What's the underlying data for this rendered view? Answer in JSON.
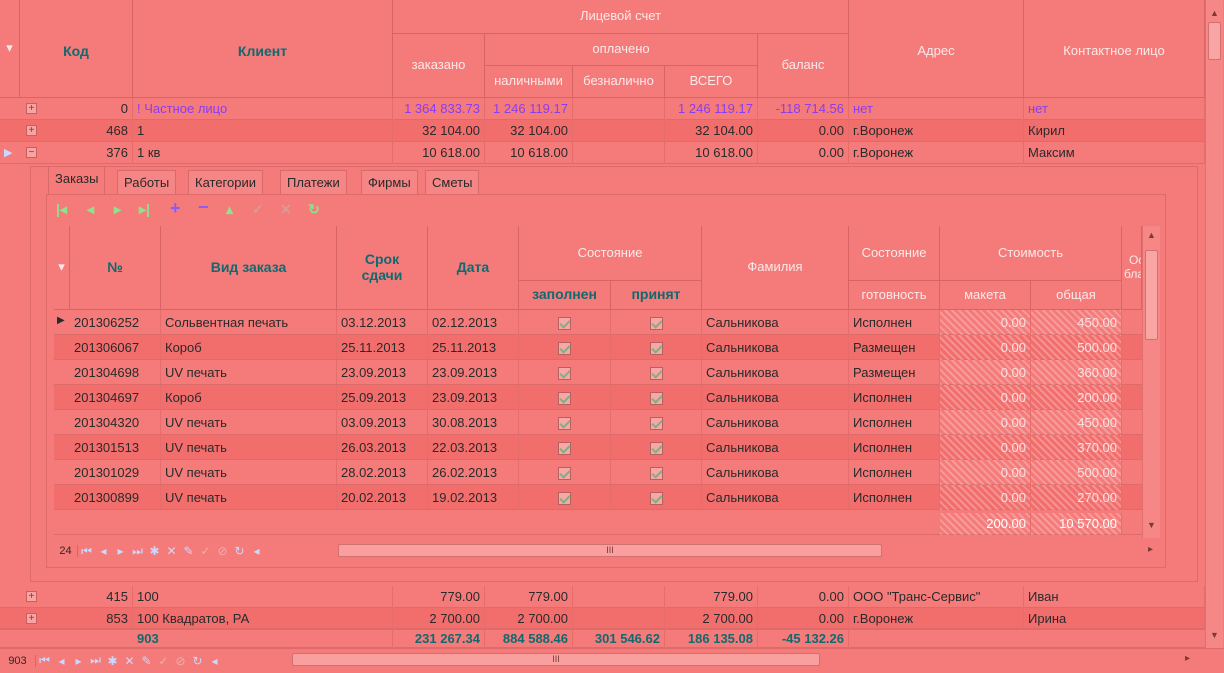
{
  "header": {
    "kod": "Код",
    "client": "Клиент",
    "account_group": "Лицевой счет",
    "ordered": "заказано",
    "paid": "оплачено",
    "cash": "наличными",
    "noncash": "безналично",
    "total": "ВСЕГО",
    "balance": "баланс",
    "address": "Адрес",
    "contact": "Контактное лицо"
  },
  "rows_top": [
    {
      "kod": "0",
      "client": "! Частное лицо",
      "ordered": "1 364 833.73",
      "cash": "1 246 119.17",
      "noncash": "",
      "total": "1 246 119.17",
      "balance": "-118 714.56",
      "address": "нет",
      "contact": "нет"
    },
    {
      "kod": "468",
      "client": "1",
      "ordered": "32 104.00",
      "cash": "32 104.00",
      "noncash": "",
      "total": "32 104.00",
      "balance": "0.00",
      "address": "г.Воронеж",
      "contact": "Кирил"
    },
    {
      "kod": "376",
      "client": "1 кв",
      "ordered": "10 618.00",
      "cash": "10 618.00",
      "noncash": "",
      "total": "10 618.00",
      "balance": "0.00",
      "address": "г.Воронеж",
      "contact": "Максим"
    }
  ],
  "rows_bottom": [
    {
      "kod": "415",
      "client": "100",
      "ordered": "779.00",
      "cash": "779.00",
      "noncash": "",
      "total": "779.00",
      "balance": "0.00",
      "address": "ООО \"Транс-Сервис\"",
      "contact": "Иван"
    },
    {
      "kod": "853",
      "client": "100 Квадратов, РА",
      "ordered": "2 700.00",
      "cash": "2 700.00",
      "noncash": "",
      "total": "2 700.00",
      "balance": "0.00",
      "address": "г.Воронеж",
      "contact": "Ирина"
    }
  ],
  "footer": {
    "count": "903",
    "ordered": "231 267.34",
    "cash": "884 588.46",
    "noncash": "301 546.62",
    "total": "186 135.08",
    "balance": "-45 132.26"
  },
  "tabs": [
    "Заказы",
    "Работы",
    "Категории",
    "Платежи",
    "Фирмы",
    "Сметы"
  ],
  "detail_header": {
    "num": "№",
    "type": "Вид заказа",
    "due": "Срок сдачи",
    "date": "Дата",
    "state": "Состояние",
    "filled": "заполнен",
    "accepted": "принят",
    "surname": "Фамилия",
    "state2": "Состояние",
    "readiness": "готовность",
    "cost": "Стоимость",
    "layout": "макета",
    "overall": "общая",
    "extra": "Осн бланк"
  },
  "orders": [
    {
      "num": "201306252",
      "type": "Сольвентная печать",
      "due": "03.12.2013",
      "date": "02.12.2013",
      "surname": "Сальникова",
      "readiness": "Исполнен",
      "layout": "0.00",
      "overall": "450.00"
    },
    {
      "num": "201306067",
      "type": "Короб",
      "due": "25.11.2013",
      "date": "25.11.2013",
      "surname": "Сальникова",
      "readiness": "Размещен",
      "layout": "0.00",
      "overall": "500.00"
    },
    {
      "num": "201304698",
      "type": "UV печать",
      "due": "23.09.2013",
      "date": "23.09.2013",
      "surname": "Сальникова",
      "readiness": "Размещен",
      "layout": "0.00",
      "overall": "360.00"
    },
    {
      "num": "201304697",
      "type": "Короб",
      "due": "25.09.2013",
      "date": "23.09.2013",
      "surname": "Сальникова",
      "readiness": "Исполнен",
      "layout": "0.00",
      "overall": "200.00"
    },
    {
      "num": "201304320",
      "type": "UV печать",
      "due": "03.09.2013",
      "date": "30.08.2013",
      "surname": "Сальникова",
      "readiness": "Исполнен",
      "layout": "0.00",
      "overall": "450.00"
    },
    {
      "num": "201301513",
      "type": "UV печать",
      "due": "26.03.2013",
      "date": "22.03.2013",
      "surname": "Сальникова",
      "readiness": "Исполнен",
      "layout": "0.00",
      "overall": "370.00"
    },
    {
      "num": "201301029",
      "type": "UV печать",
      "due": "28.02.2013",
      "date": "26.02.2013",
      "surname": "Сальникова",
      "readiness": "Исполнен",
      "layout": "0.00",
      "overall": "500.00"
    },
    {
      "num": "201300899",
      "type": "UV печать",
      "due": "20.02.2013",
      "date": "19.02.2013",
      "surname": "Сальникова",
      "readiness": "Исполнен",
      "layout": "0.00",
      "overall": "270.00"
    }
  ],
  "detail_footer": {
    "layout": "200.00",
    "overall": "10 570.00"
  },
  "detail_nav_count": "24",
  "main_nav_count": "903",
  "scroll_grip": "III"
}
